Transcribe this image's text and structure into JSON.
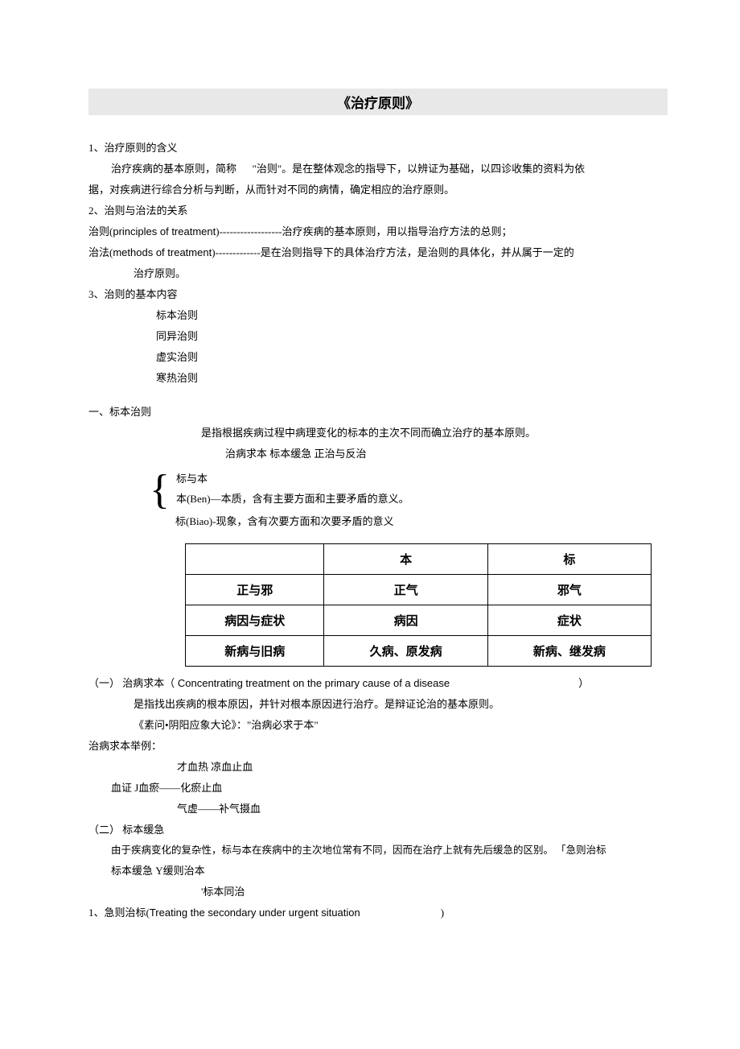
{
  "title": "《治疗原则》",
  "s1": {
    "h": "1、治疗原则的含义",
    "p1": "治疗疾病的基本原则，简称",
    "p1q": "\"治则\"",
    "p1b": "。是在整体观念的指导下，以辨证为基础，以四诊收集的资料为依",
    "p2": "据，对疾病进行综合分析与判断，从而针对不同的病情，确定相应的治疗原则。"
  },
  "s2": {
    "h": "2、治则与治法的关系",
    "l1a": "治则(",
    "l1en": "principles of treatment",
    "l1b": ")------------------治疗疾病的基本原则，用以指导治疗方法的总则；",
    "l2a": "治法(",
    "l2en": "methods of treatment",
    "l2b": ")-------------是在治则指导下的具体治疗方法，是治则的具体化，并从属于一定的",
    "l3": "治疗原则。"
  },
  "s3": {
    "h": "3、治则的基本内容",
    "items": [
      "标本治则",
      "同异治则",
      "虚实治则",
      "寒热治则"
    ]
  },
  "sec1": {
    "h": "一、标本治则",
    "p": "是指根据疾病过程中病理变化的标本的主次不同而确立治疗的基本原则。",
    "brace_top": "治病求本  标本缓急  正治与反治",
    "brace_items": [
      "标与本",
      "本(Ben)—本质，含有主要方面和主要矛盾的意义。",
      "标(Biao)-现象，含有次要方面和次要矛盾的意义"
    ]
  },
  "table": {
    "headers": [
      "",
      "本",
      "标"
    ],
    "rows": [
      [
        "正与邪",
        "正气",
        "邪气"
      ],
      [
        "病因与症状",
        "病因",
        "症状"
      ],
      [
        "新病与旧病",
        "久病、原发病",
        "新病、继发病"
      ]
    ]
  },
  "sub1": {
    "h_a": "（一） 治病求本（",
    "h_en": " Concentrating treatment on the primary cause of a disease",
    "h_b": "）",
    "p1": "是指找出疾病的根本原因，并针对根本原因进行治疗。是辩证论治的基本原则。",
    "p2": "《素问•阴阳应象大论》：\"治病必求于本\""
  },
  "ex": {
    "h": "治病求本举例：",
    "l1": "才血热      凉血止血",
    "l2": "血证  J血瘀——化瘀止血",
    "l3": "气虚——补气摄血"
  },
  "sub2": {
    "h": "（二） 标本缓急",
    "p1": "由于疾病变化的复杂性，标与本在疾病中的主次地位常有不同，因而在治疗上就有先后缓急的区别。   「急则治标",
    "p2": "标本缓急       Y缓则治本",
    "p3": "'标本同治"
  },
  "s1n": {
    "a": "1、急则治标(",
    "en": "Treating the secondary under urgent situation",
    "b": ")"
  }
}
